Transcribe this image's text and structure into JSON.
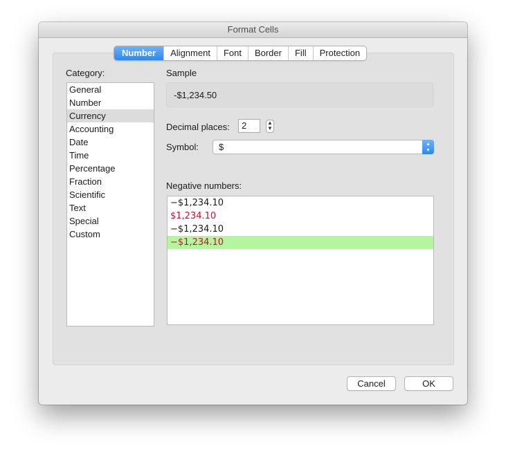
{
  "window": {
    "title": "Format Cells"
  },
  "tabs": [
    {
      "label": "Number",
      "active": true
    },
    {
      "label": "Alignment"
    },
    {
      "label": "Font"
    },
    {
      "label": "Border"
    },
    {
      "label": "Fill"
    },
    {
      "label": "Protection"
    }
  ],
  "category": {
    "label": "Category:",
    "items": [
      "General",
      "Number",
      "Currency",
      "Accounting",
      "Date",
      "Time",
      "Percentage",
      "Fraction",
      "Scientific",
      "Text",
      "Special",
      "Custom"
    ],
    "selected": "Currency"
  },
  "sample": {
    "label": "Sample",
    "value": "-$1,234.50"
  },
  "decimal_places": {
    "label": "Decimal places:",
    "value": "2"
  },
  "symbol": {
    "label": "Symbol:",
    "value": "$"
  },
  "negative_numbers": {
    "label": "Negative numbers:",
    "items": [
      "−$1,234.10",
      "$1,234.10",
      "−$1,234.10",
      "−$1,234.10"
    ],
    "red_items": [
      1,
      3
    ],
    "selected": 3
  },
  "buttons": {
    "cancel": "Cancel",
    "ok": "OK"
  },
  "colors": {
    "accent": "#2d87f0",
    "negative_red": "#c8102e",
    "selection_green": "#b4f5a0"
  }
}
